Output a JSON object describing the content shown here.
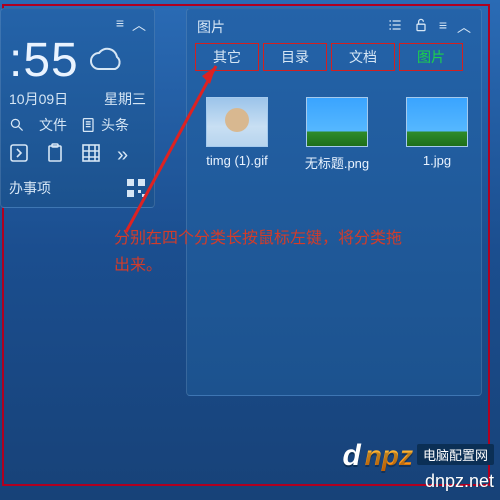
{
  "clock": {
    "menu_icon": "≡",
    "collapse_icon": "︿",
    "time": ":55",
    "date": "10月09日",
    "weekday": "星期三",
    "quick": {
      "search_icon": "search",
      "file_label": "文件",
      "news_icon": "doc",
      "news_label": "头条"
    },
    "iconrow": {
      "right_icon": "›",
      "box_icon": "☐",
      "grid_icon": "▦",
      "more_icon": "»"
    },
    "todo_label": "办事项"
  },
  "panel": {
    "title": "图片",
    "head_icons": {
      "list": "≡",
      "lock": "🔒",
      "menu": "≡",
      "collapse": "︿"
    },
    "tabs": [
      {
        "label": "其它",
        "active": false
      },
      {
        "label": "目录",
        "active": false
      },
      {
        "label": "文档",
        "active": false
      },
      {
        "label": "图片",
        "active": true
      }
    ],
    "thumbs": [
      {
        "label": "timg (1).gif",
        "kind": "person"
      },
      {
        "label": "无标题.png",
        "kind": "sky"
      },
      {
        "label": "1.jpg",
        "kind": "sky"
      }
    ]
  },
  "annotation": {
    "line1": "分别在四个分类长按鼠标左键，将分类拖",
    "line2": "出来。"
  },
  "watermark": {
    "logo_d": "d",
    "logo_rest": "npz",
    "sub": "电脑配置网",
    "url": "dnpz.net"
  },
  "colors": {
    "highlight_box": "#d32020",
    "annotation": "#d23c2a",
    "active_tab": "#1cd24a"
  }
}
